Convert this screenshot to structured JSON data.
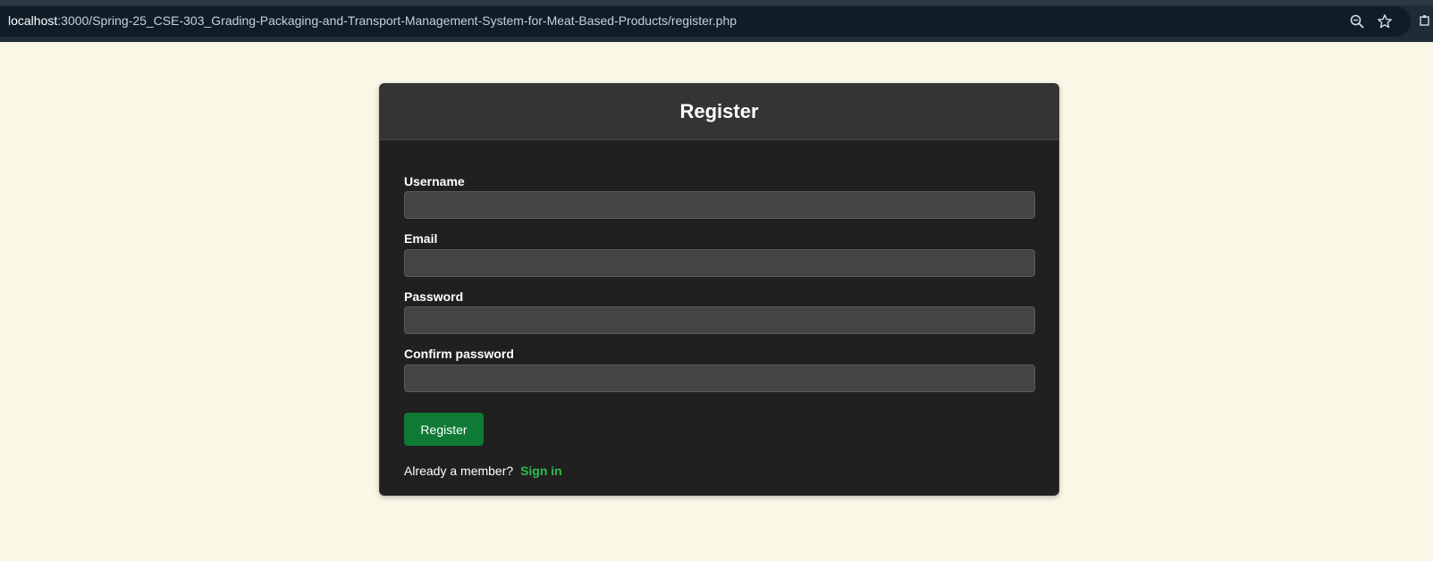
{
  "browser": {
    "url_host": "localhost",
    "url_rest": ":3000/Spring-25_CSE-303_Grading-Packaging-and-Transport-Management-System-for-Meat-Based-Products/register.php",
    "icons": [
      "zoom-icon",
      "bookmark-star-icon",
      "extensions-icon"
    ]
  },
  "form": {
    "title": "Register",
    "fields": [
      {
        "label": "Username",
        "value": "",
        "type": "text"
      },
      {
        "label": "Email",
        "value": "",
        "type": "email"
      },
      {
        "label": "Password",
        "value": "",
        "type": "password"
      },
      {
        "label": "Confirm password",
        "value": "",
        "type": "password"
      }
    ],
    "submit_label": "Register",
    "member_prompt": "Already a member?",
    "signin_label": "Sign in"
  },
  "colors": {
    "page_background": "#f9f8e6",
    "card_background": "#202020",
    "header_background": "#343434",
    "input_background": "#444444",
    "button_green": "#0e7a35",
    "link_green": "#2dbd4e"
  }
}
